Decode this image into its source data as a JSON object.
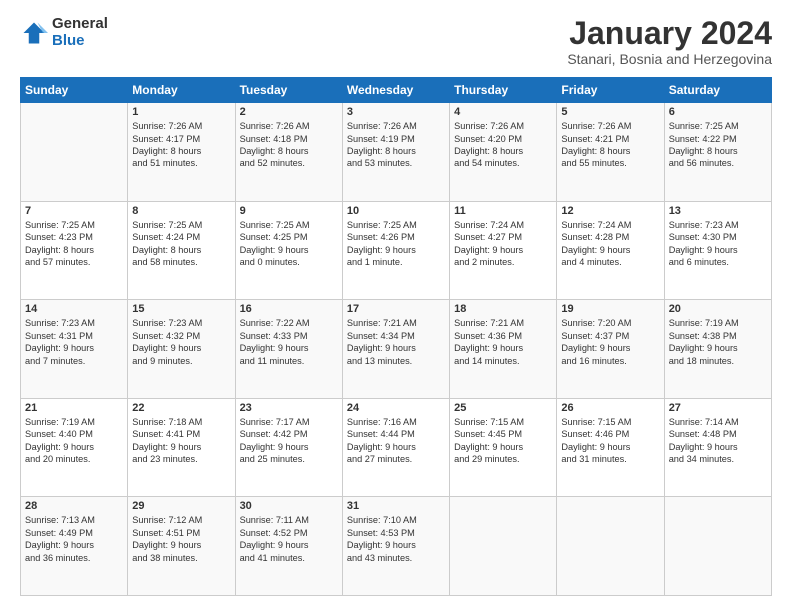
{
  "logo": {
    "general": "General",
    "blue": "Blue"
  },
  "title": "January 2024",
  "location": "Stanari, Bosnia and Herzegovina",
  "weekdays": [
    "Sunday",
    "Monday",
    "Tuesday",
    "Wednesday",
    "Thursday",
    "Friday",
    "Saturday"
  ],
  "weeks": [
    [
      {
        "day": "",
        "info": ""
      },
      {
        "day": "1",
        "info": "Sunrise: 7:26 AM\nSunset: 4:17 PM\nDaylight: 8 hours\nand 51 minutes."
      },
      {
        "day": "2",
        "info": "Sunrise: 7:26 AM\nSunset: 4:18 PM\nDaylight: 8 hours\nand 52 minutes."
      },
      {
        "day": "3",
        "info": "Sunrise: 7:26 AM\nSunset: 4:19 PM\nDaylight: 8 hours\nand 53 minutes."
      },
      {
        "day": "4",
        "info": "Sunrise: 7:26 AM\nSunset: 4:20 PM\nDaylight: 8 hours\nand 54 minutes."
      },
      {
        "day": "5",
        "info": "Sunrise: 7:26 AM\nSunset: 4:21 PM\nDaylight: 8 hours\nand 55 minutes."
      },
      {
        "day": "6",
        "info": "Sunrise: 7:25 AM\nSunset: 4:22 PM\nDaylight: 8 hours\nand 56 minutes."
      }
    ],
    [
      {
        "day": "7",
        "info": "Sunrise: 7:25 AM\nSunset: 4:23 PM\nDaylight: 8 hours\nand 57 minutes."
      },
      {
        "day": "8",
        "info": "Sunrise: 7:25 AM\nSunset: 4:24 PM\nDaylight: 8 hours\nand 58 minutes."
      },
      {
        "day": "9",
        "info": "Sunrise: 7:25 AM\nSunset: 4:25 PM\nDaylight: 9 hours\nand 0 minutes."
      },
      {
        "day": "10",
        "info": "Sunrise: 7:25 AM\nSunset: 4:26 PM\nDaylight: 9 hours\nand 1 minute."
      },
      {
        "day": "11",
        "info": "Sunrise: 7:24 AM\nSunset: 4:27 PM\nDaylight: 9 hours\nand 2 minutes."
      },
      {
        "day": "12",
        "info": "Sunrise: 7:24 AM\nSunset: 4:28 PM\nDaylight: 9 hours\nand 4 minutes."
      },
      {
        "day": "13",
        "info": "Sunrise: 7:23 AM\nSunset: 4:30 PM\nDaylight: 9 hours\nand 6 minutes."
      }
    ],
    [
      {
        "day": "14",
        "info": "Sunrise: 7:23 AM\nSunset: 4:31 PM\nDaylight: 9 hours\nand 7 minutes."
      },
      {
        "day": "15",
        "info": "Sunrise: 7:23 AM\nSunset: 4:32 PM\nDaylight: 9 hours\nand 9 minutes."
      },
      {
        "day": "16",
        "info": "Sunrise: 7:22 AM\nSunset: 4:33 PM\nDaylight: 9 hours\nand 11 minutes."
      },
      {
        "day": "17",
        "info": "Sunrise: 7:21 AM\nSunset: 4:34 PM\nDaylight: 9 hours\nand 13 minutes."
      },
      {
        "day": "18",
        "info": "Sunrise: 7:21 AM\nSunset: 4:36 PM\nDaylight: 9 hours\nand 14 minutes."
      },
      {
        "day": "19",
        "info": "Sunrise: 7:20 AM\nSunset: 4:37 PM\nDaylight: 9 hours\nand 16 minutes."
      },
      {
        "day": "20",
        "info": "Sunrise: 7:19 AM\nSunset: 4:38 PM\nDaylight: 9 hours\nand 18 minutes."
      }
    ],
    [
      {
        "day": "21",
        "info": "Sunrise: 7:19 AM\nSunset: 4:40 PM\nDaylight: 9 hours\nand 20 minutes."
      },
      {
        "day": "22",
        "info": "Sunrise: 7:18 AM\nSunset: 4:41 PM\nDaylight: 9 hours\nand 23 minutes."
      },
      {
        "day": "23",
        "info": "Sunrise: 7:17 AM\nSunset: 4:42 PM\nDaylight: 9 hours\nand 25 minutes."
      },
      {
        "day": "24",
        "info": "Sunrise: 7:16 AM\nSunset: 4:44 PM\nDaylight: 9 hours\nand 27 minutes."
      },
      {
        "day": "25",
        "info": "Sunrise: 7:15 AM\nSunset: 4:45 PM\nDaylight: 9 hours\nand 29 minutes."
      },
      {
        "day": "26",
        "info": "Sunrise: 7:15 AM\nSunset: 4:46 PM\nDaylight: 9 hours\nand 31 minutes."
      },
      {
        "day": "27",
        "info": "Sunrise: 7:14 AM\nSunset: 4:48 PM\nDaylight: 9 hours\nand 34 minutes."
      }
    ],
    [
      {
        "day": "28",
        "info": "Sunrise: 7:13 AM\nSunset: 4:49 PM\nDaylight: 9 hours\nand 36 minutes."
      },
      {
        "day": "29",
        "info": "Sunrise: 7:12 AM\nSunset: 4:51 PM\nDaylight: 9 hours\nand 38 minutes."
      },
      {
        "day": "30",
        "info": "Sunrise: 7:11 AM\nSunset: 4:52 PM\nDaylight: 9 hours\nand 41 minutes."
      },
      {
        "day": "31",
        "info": "Sunrise: 7:10 AM\nSunset: 4:53 PM\nDaylight: 9 hours\nand 43 minutes."
      },
      {
        "day": "",
        "info": ""
      },
      {
        "day": "",
        "info": ""
      },
      {
        "day": "",
        "info": ""
      }
    ]
  ]
}
